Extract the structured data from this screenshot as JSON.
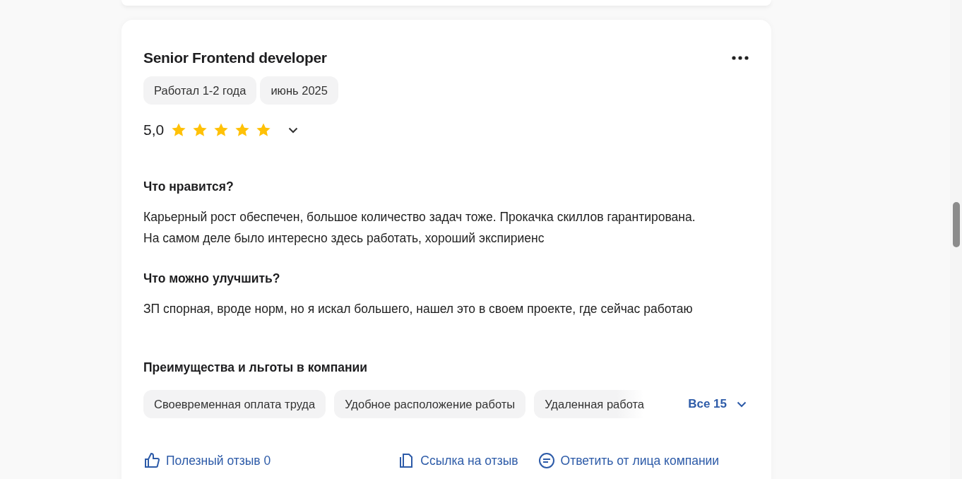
{
  "review": {
    "title": "Senior Frontend developer",
    "tags": [
      "Работал 1-2 года",
      "июнь 2025"
    ],
    "rating": "5,0",
    "stars": 5,
    "sections": [
      {
        "heading": "Что нравится?",
        "text": "Карьерный рост обеспечен, большое количество задач тоже. Прокачка скиллов гарантирована. На самом деле было интересно здесь работать, хороший экспириенс"
      },
      {
        "heading": "Что можно улучшить?",
        "text": "ЗП спорная, вроде норм, но я искал большего, нашел это в своем проекте, где сейчас работаю"
      }
    ],
    "benefits": {
      "heading": "Преимущества и льготы в компании",
      "items": [
        "Своевременная оплата труда",
        "Удобное расположение работы",
        "Удаленная работа"
      ],
      "more": "Все 15"
    },
    "actions": [
      {
        "kind": "like",
        "label": "Полезный отзыв 0"
      },
      {
        "kind": "link",
        "label": "Ссылка на отзыв"
      },
      {
        "kind": "reply",
        "label": "Ответить от лица компании"
      }
    ]
  }
}
